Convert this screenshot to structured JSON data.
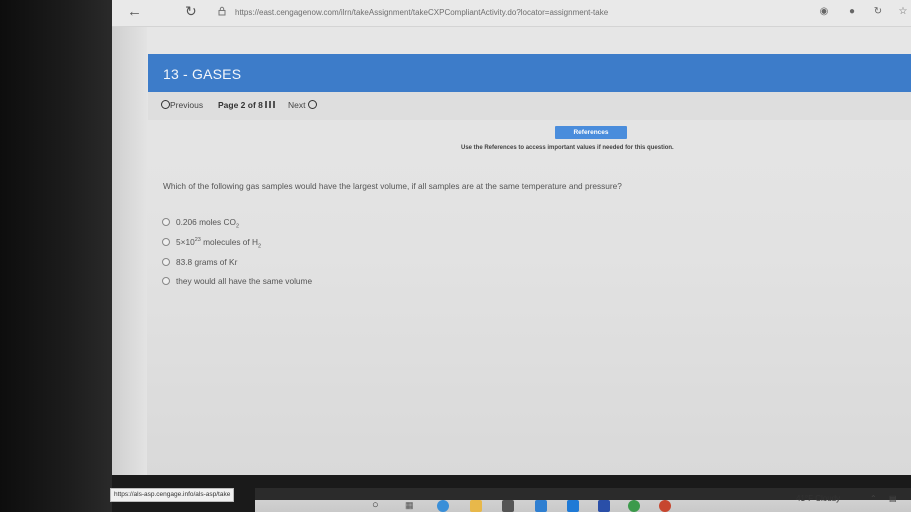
{
  "browser": {
    "url": "https://east.cengagenow.com/ilrn/takeAssignment/takeCXPCompliantActivity.do?locator=assignment-take"
  },
  "assignment": {
    "title": "13 - GASES"
  },
  "nav": {
    "previous_label": "Previous",
    "page_label": "Page 2 of 8",
    "next_label": "Next"
  },
  "references": {
    "button_label": "References",
    "note": "Use the References to access important values if needed for this question."
  },
  "question": {
    "text": "Which of the following gas samples would have the largest volume, if all samples are at the same temperature and pressure?",
    "options": [
      {
        "pre": "0.206 moles CO",
        "sub": "2",
        "sup": "",
        "mid": "",
        "sub2": ""
      },
      {
        "pre": "5×10",
        "sup": "23",
        "mid": " molecules of H",
        "sub2": "2",
        "sub": ""
      },
      {
        "pre": "83.8 grams of Kr",
        "sub": "",
        "sup": "",
        "mid": "",
        "sub2": ""
      },
      {
        "pre": "they would all have the same volume",
        "sub": "",
        "sup": "",
        "mid": "",
        "sub2": ""
      }
    ]
  },
  "status_bar": {
    "url": "https://als-asp.cengage.info/als-asp/take"
  },
  "taskbar": {
    "weather": "41°F  Cloudy"
  },
  "colors": {
    "banner": "#3d7cc9",
    "references_button": "#4a8ddc"
  }
}
